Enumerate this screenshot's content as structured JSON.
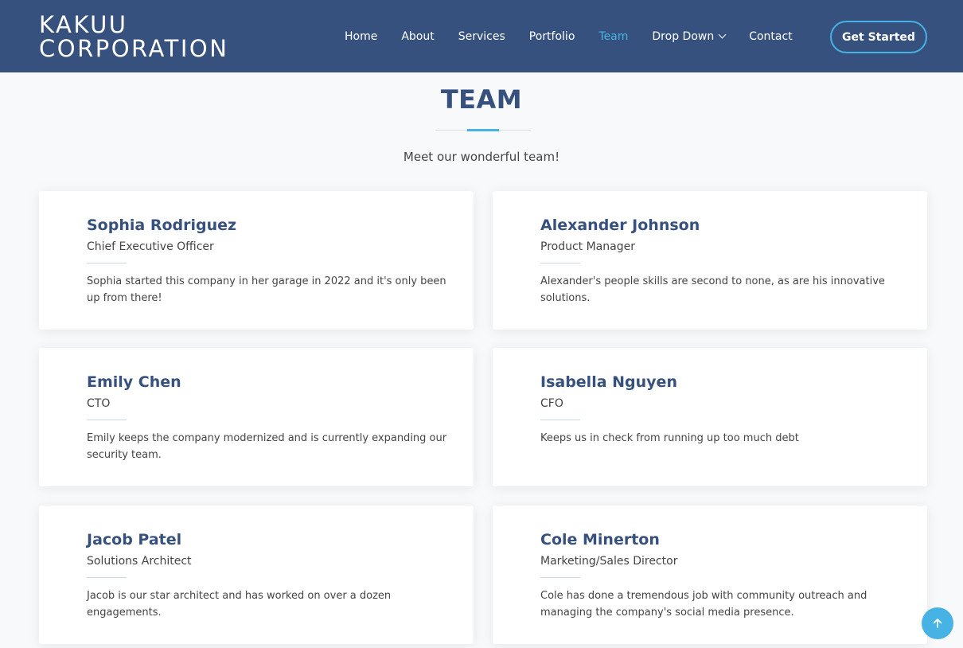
{
  "header": {
    "logo_line1": "KAKUU",
    "logo_line2": "CORPORATION",
    "nav": [
      "Home",
      "About",
      "Services",
      "Portfolio",
      "Team",
      "Drop Down",
      "Contact"
    ],
    "active_item": "Team",
    "cta_label": "Get Started"
  },
  "section": {
    "title": "TEAM",
    "subtitle": "Meet our wonderful team!"
  },
  "team": [
    {
      "name": "Sophia Rodriguez",
      "role": "Chief Executive Officer",
      "bio": "Sophia started this company in her garage in 2022 and it's only been up from there!"
    },
    {
      "name": "Alexander Johnson",
      "role": "Product Manager",
      "bio": "Alexander's people skills are second to none, as are his innovative solutions."
    },
    {
      "name": "Emily Chen",
      "role": "CTO",
      "bio": "Emily keeps the company modernized and is currently expanding our security team."
    },
    {
      "name": "Isabella Nguyen",
      "role": "CFO",
      "bio": "Keeps us in check from running up too much debt"
    },
    {
      "name": "Jacob Patel",
      "role": "Solutions Architect",
      "bio": "Jacob is our star architect and has worked on over a dozen engagements."
    },
    {
      "name": "Cole Minerton",
      "role": "Marketing/Sales Director",
      "bio": "Cole has done a tremendous job with community outreach and managing the company's social media presence."
    }
  ],
  "icons": {
    "dropdown": "chevron-down-icon",
    "back_to_top": "arrow-up-icon"
  },
  "colors": {
    "header_bg": "#37517e",
    "accent": "#47b2e4",
    "page_bg": "#f7f9fb"
  }
}
